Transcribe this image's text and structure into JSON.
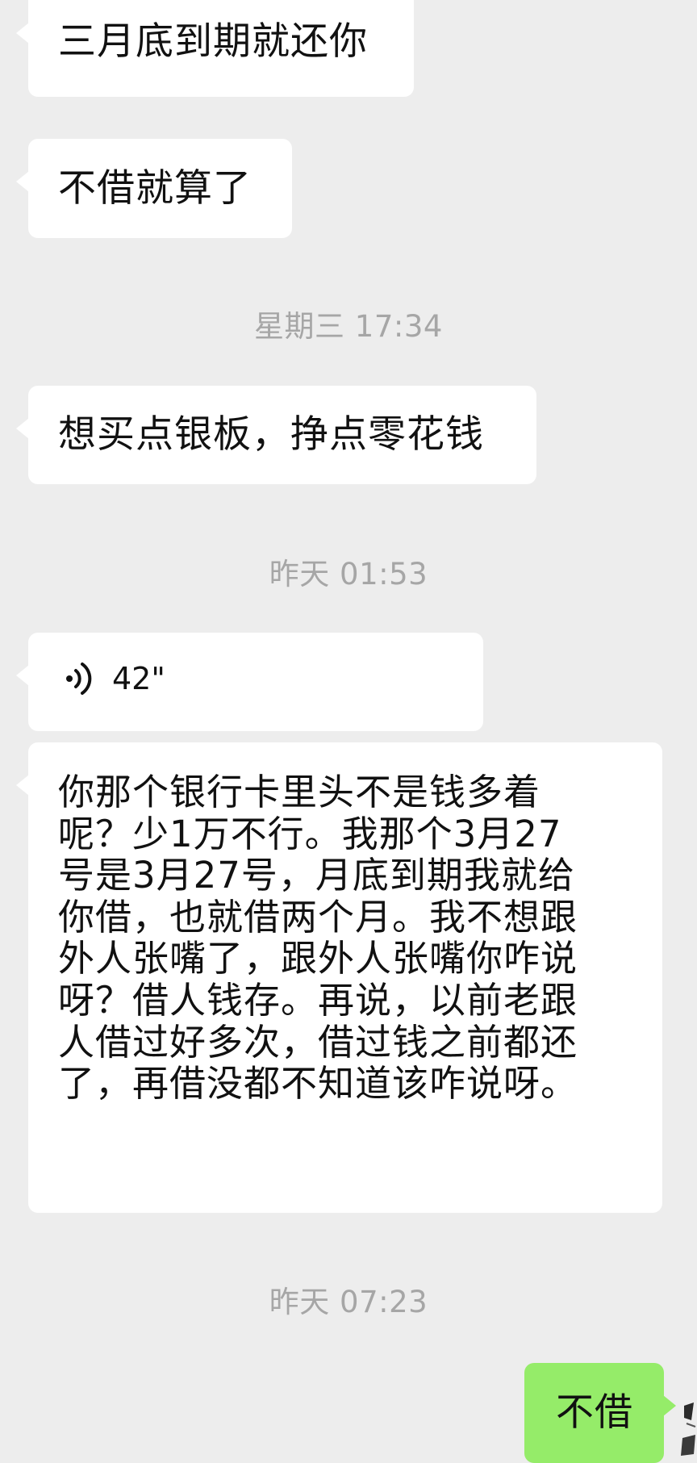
{
  "messages": {
    "m1": {
      "text": "三月底到期就还你"
    },
    "m2": {
      "text": "不借就算了"
    },
    "time1": "星期三 17:34",
    "m3": {
      "text": "想买点银板，挣点零花钱"
    },
    "time2": "昨天 01:53",
    "voice": {
      "duration": "42\"",
      "icon": "voice-wave-icon"
    },
    "m4": {
      "lines": [
        "你那个银行卡里头不是钱多着",
        "呢？少1万不行。我那个3月27",
        "号是3月27号，月底到期我就给",
        "你借，也就借两个月。我不想跟",
        "外人张嘴了，跟外人张嘴你咋说",
        "呀？借人钱存。再说，以前老跟",
        "人借过好多次，借过钱之前都还",
        "了，再借没都不知道该咋说呀。"
      ]
    },
    "time3": "昨天 07:23",
    "m5": {
      "text": "不借"
    }
  },
  "colors": {
    "background": "#ededed",
    "incoming_bubble": "#ffffff",
    "outgoing_bubble": "#95ec69",
    "timestamp": "#a6a6a6"
  }
}
